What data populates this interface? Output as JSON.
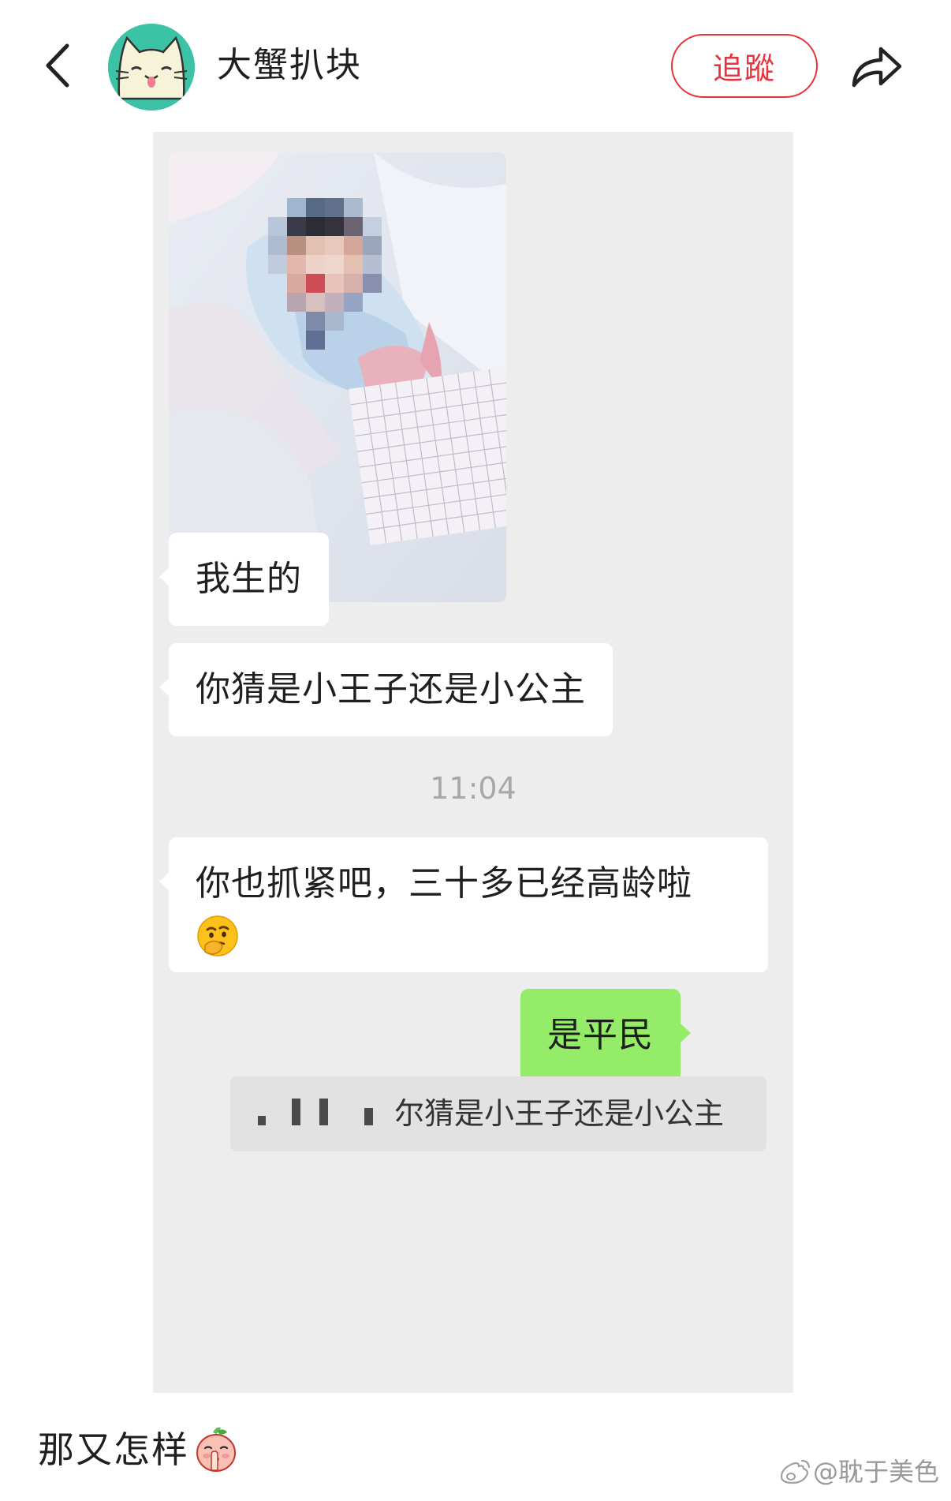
{
  "header": {
    "back_icon": "chevron-left-icon",
    "username": "大蟹扒块",
    "follow_label": "追蹤",
    "share_icon": "share-arrow-icon",
    "accent_color": "#e8323d"
  },
  "chat": {
    "messages": [
      {
        "type": "image",
        "side": "left",
        "content": "blurred baby photo"
      },
      {
        "type": "text",
        "side": "left",
        "text": "我生的"
      },
      {
        "type": "text",
        "side": "left",
        "text": "你猜是小王子还是小公主"
      },
      {
        "type": "timestamp",
        "text": "11:04"
      },
      {
        "type": "text",
        "side": "left",
        "text": "你也抓紧吧，三十多已经高龄啦",
        "emoji": "thinking-face-emoji"
      },
      {
        "type": "text",
        "side": "right",
        "text": "是平民"
      }
    ],
    "quote": {
      "text": "你猜是小王子还是小公主",
      "visible_text": "尔猜是小王子还是小公主"
    },
    "bubble_colors": {
      "incoming": "#ffffff",
      "outgoing": "#95ec69",
      "background": "#ededed"
    }
  },
  "caption": {
    "text": "那又怎样",
    "emoji": "shushing-peach-emoji"
  },
  "watermark": {
    "text": "@耽于美色",
    "icon": "weibo-logo-icon"
  }
}
